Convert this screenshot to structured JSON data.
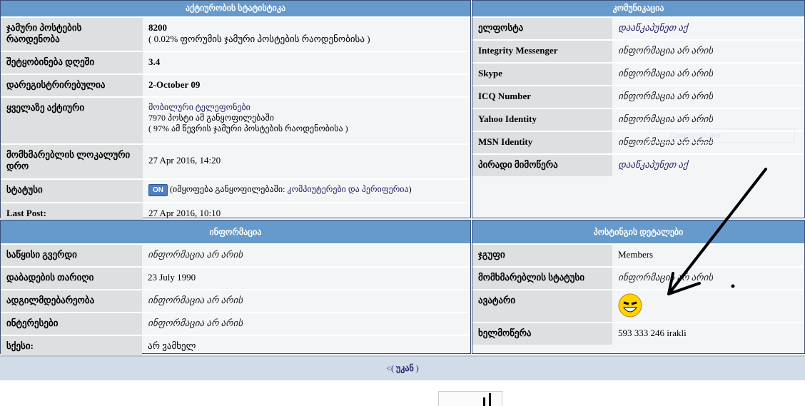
{
  "activity": {
    "title": "აქტიურობის სტატისტიკა",
    "rows": [
      {
        "label": "ჯამური პოსტების რაოდენობა",
        "value": "8200",
        "note": "( 0.02% ფორუმის ჯამური პოსტების რაოდენობისა )"
      },
      {
        "label": "შეტყობინება დღეში",
        "value": "3.4"
      },
      {
        "label": "დარეგისტრირებულია",
        "value": "2-October 09"
      },
      {
        "label": "ყველაზე აქტიური",
        "forum": "მობილური ტელეფონები",
        "posts": "7970 პოსტი ამ განყოფილებაში",
        "percent": "( 97% ამ წევრის ჯამური პოსტების რაოდენობისა )"
      },
      {
        "label": "მომხმარებლის ლოკალური დრო",
        "value": "27 Apr 2016, 14:20"
      },
      {
        "label": "სტატუსი",
        "badge": "ON",
        "prefix": "(იმყოფება განყოფილებაში: ",
        "section": "კომპიუტერები და პერიფერია",
        "suffix": ")"
      },
      {
        "label": "Last Post:",
        "value": "27 Apr 2016, 10:10"
      }
    ]
  },
  "communication": {
    "title": "კომუნიკაცია",
    "rows": [
      {
        "label": "ელფოსტა",
        "value": "დააწკაპუნეთ აქ"
      },
      {
        "label": "Integrity Messenger",
        "value": "ინფორმაცია არ არის"
      },
      {
        "label": "Skype",
        "value": "ინფორმაცია არ არის"
      },
      {
        "label": "ICQ Number",
        "value": "ინფორმაცია არ არის"
      },
      {
        "label": "Yahoo Identity",
        "value": "ინფორმაცია არ არის"
      },
      {
        "label": "MSN Identity",
        "value": "ინფორმაცია არ არის"
      },
      {
        "label": "პირადი მიმოწერა",
        "value": "დააწკაპუნეთ აქ"
      }
    ],
    "tooltip": "Прямоугольник"
  },
  "info": {
    "title": "ინფორმაცია",
    "rows": [
      {
        "label": "საწყისი გვერდი",
        "value": "ინფორმაცია არ არის"
      },
      {
        "label": "დაბადების თარიღი",
        "value": "23 July 1990"
      },
      {
        "label": "ადგილმდებარეობა",
        "value": "ინფორმაცია არ არის"
      },
      {
        "label": "ინტერესები",
        "value": "ინფორმაცია არ არის"
      },
      {
        "label": "სქესი:",
        "value": "არ ვამხელ"
      }
    ]
  },
  "posting": {
    "title": "პოსტინგის დეტალები",
    "rows": [
      {
        "label": "ჯგუფი",
        "value": "Members"
      },
      {
        "label": "მომხმარებლის სტატუსი",
        "value": "ინფორმაცია არ არის"
      },
      {
        "label": "ავატარი"
      },
      {
        "label": "ხელმოწერა",
        "value": "593 333 246 irakli"
      }
    ]
  },
  "back": {
    "prefix": "<( ",
    "label": "უკან",
    "suffix": " )"
  }
}
